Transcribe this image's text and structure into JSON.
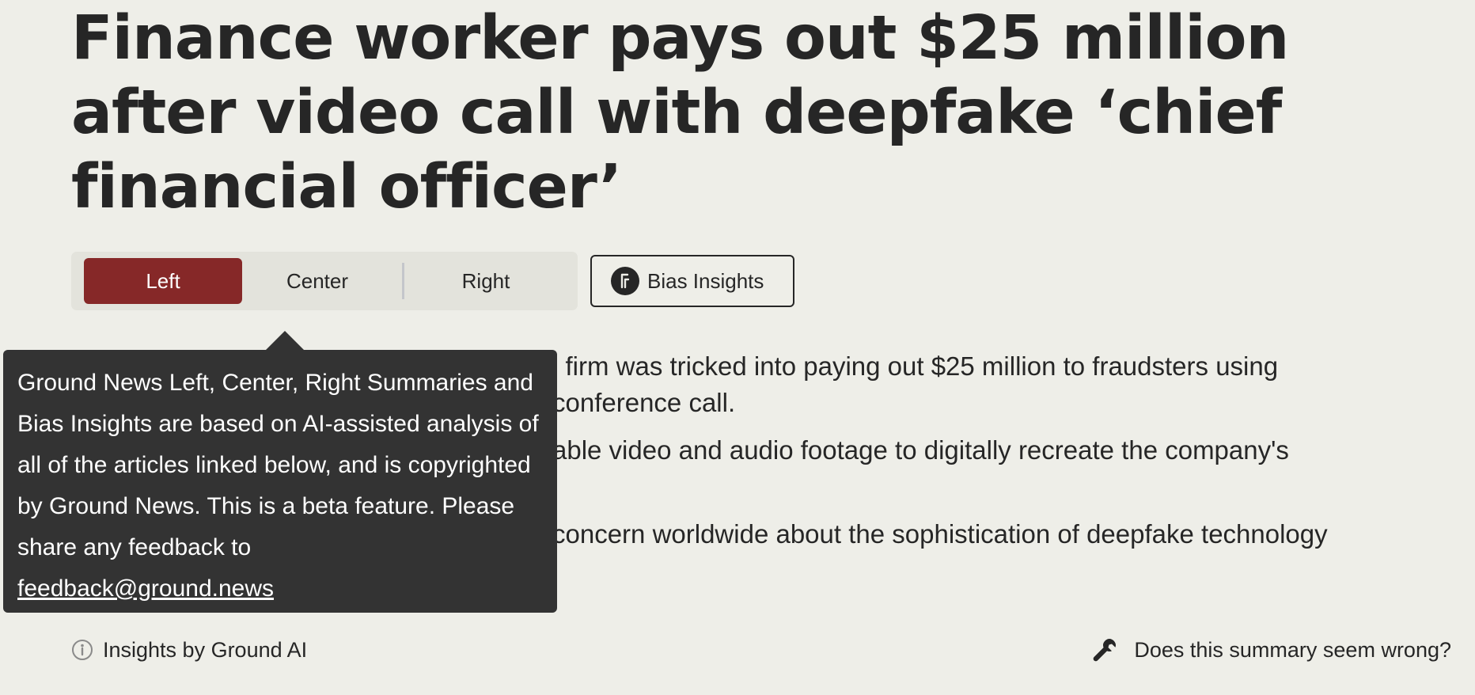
{
  "headline": "Finance worker pays out $25 million after video call with deepfake ‘chief financial officer’",
  "tabs": {
    "left": "Left",
    "center": "Center",
    "right": "Right",
    "selected": "Left"
  },
  "bias_button": {
    "label": "Bias Insights",
    "icon": "ground-news-logo-icon"
  },
  "summary": {
    "line1a": "l firm was tricked into paying out $25 million to fraudsters using",
    "line1b": "conference call.",
    "line2": "able video and audio footage to digitally recreate the company's",
    "line3": "concern worldwide about the sophistication of deepfake technology"
  },
  "tooltip": {
    "text": "Ground News Left, Center, Right Summaries and Bias Insights are based on AI-assisted analysis of all of the articles linked below, and is copyrighted by Ground News. This is a beta feature. Please share any feedback to",
    "email": "feedback@ground.news"
  },
  "footer": {
    "insights_label": "Insights by Ground AI",
    "insights_icon": "info-icon",
    "feedback_label": "Does this summary seem wrong?",
    "feedback_icon": "wrench-icon"
  },
  "colors": {
    "background": "#eeeee8",
    "accent_left": "#862828",
    "tooltip_bg": "#333333",
    "text": "#262626"
  }
}
